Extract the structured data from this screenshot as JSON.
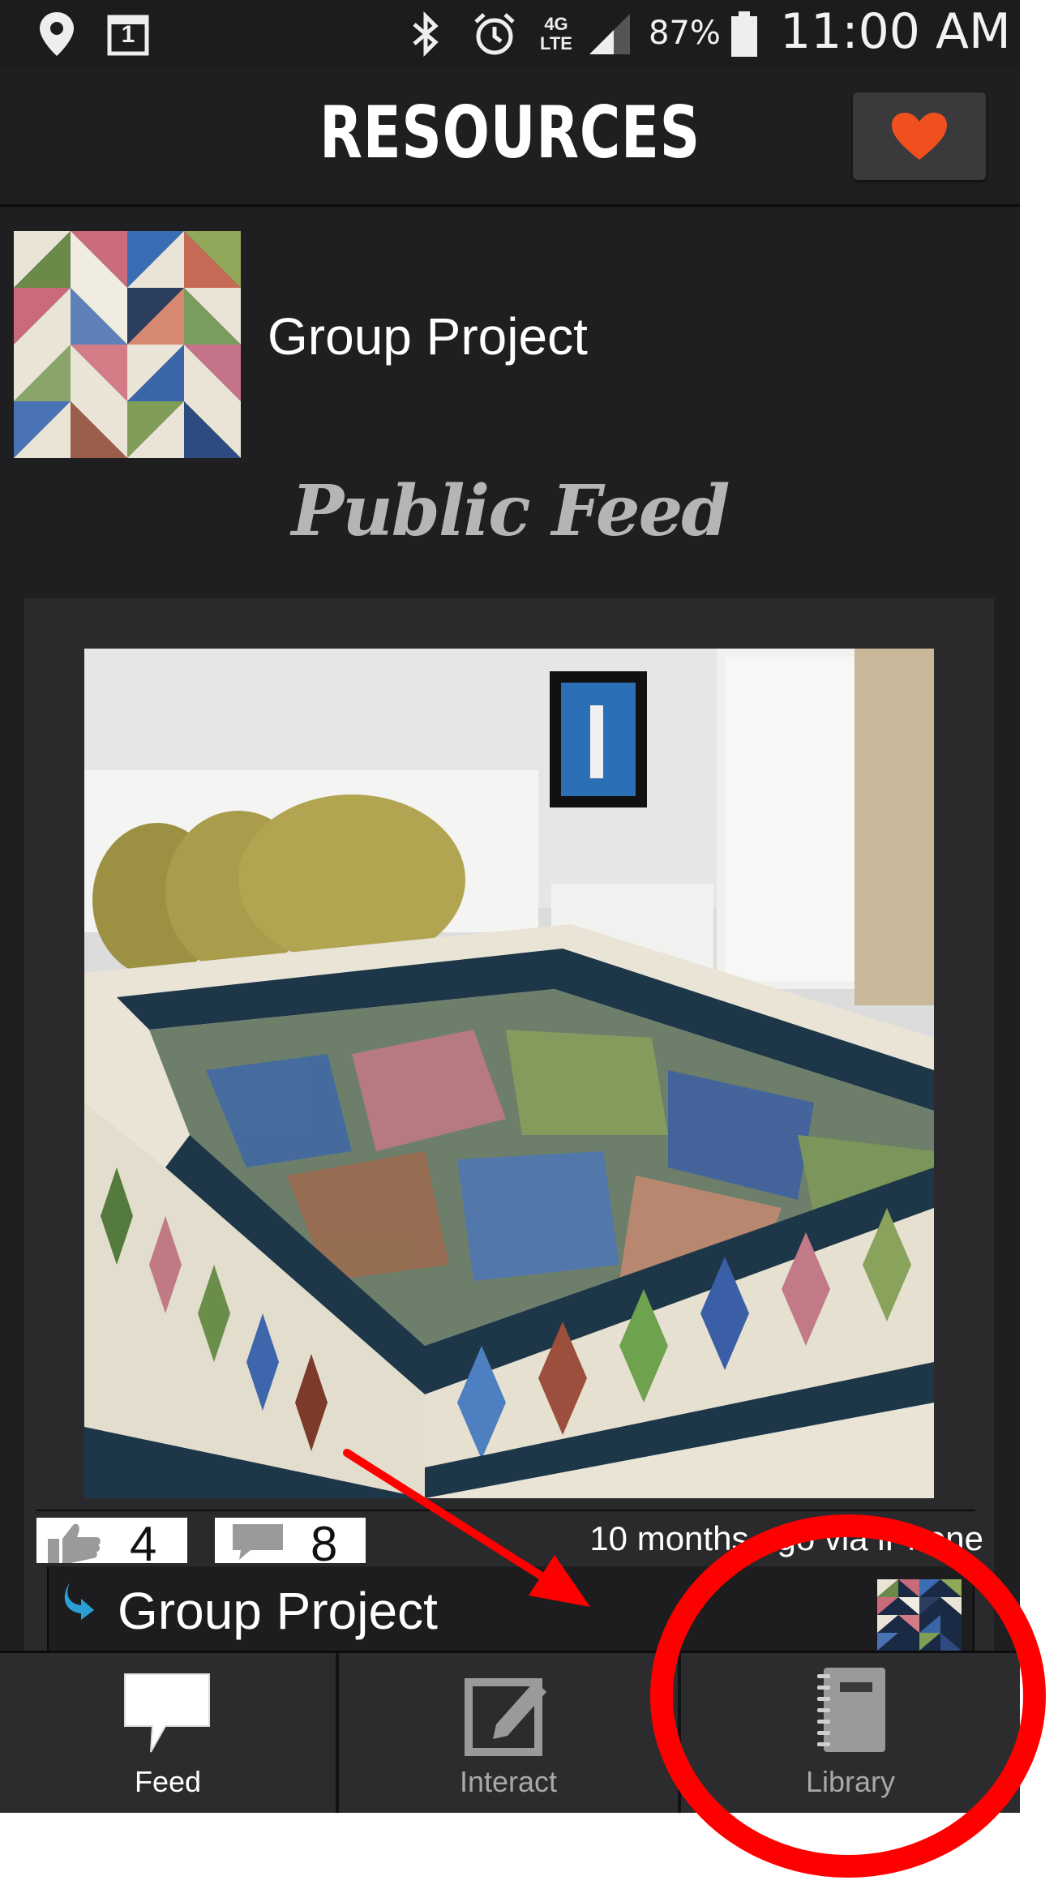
{
  "status_bar": {
    "battery": "87%",
    "time": "11:00 AM",
    "network": "4G LTE",
    "calendar_day": "1",
    "icons": [
      "location-icon",
      "calendar-icon",
      "bluetooth-icon",
      "alarm-icon",
      "network-4g-icon",
      "signal-icon",
      "battery-icon"
    ]
  },
  "header": {
    "title": "RESOURCES",
    "favorite_icon": "heart-icon",
    "accent": "#f0501e"
  },
  "group": {
    "name": "Group Project"
  },
  "feed": {
    "title": "Public Feed"
  },
  "post": {
    "likes": "4",
    "comments": "8",
    "time": "10 months ago via iPhone",
    "repost_group": "Group Project"
  },
  "tabs": [
    {
      "label": "Feed",
      "icon": "speech-bubble-icon",
      "active": true
    },
    {
      "label": "Interact",
      "icon": "edit-icon",
      "active": false
    },
    {
      "label": "Library",
      "icon": "notebook-icon",
      "active": false
    }
  ],
  "colors": {
    "background": "#1f1f21",
    "tab_active": "#ffffff",
    "tab_inactive": "#a8a8a8",
    "annotation": "#ff0000",
    "repost_arrow": "#2a9fd6"
  }
}
